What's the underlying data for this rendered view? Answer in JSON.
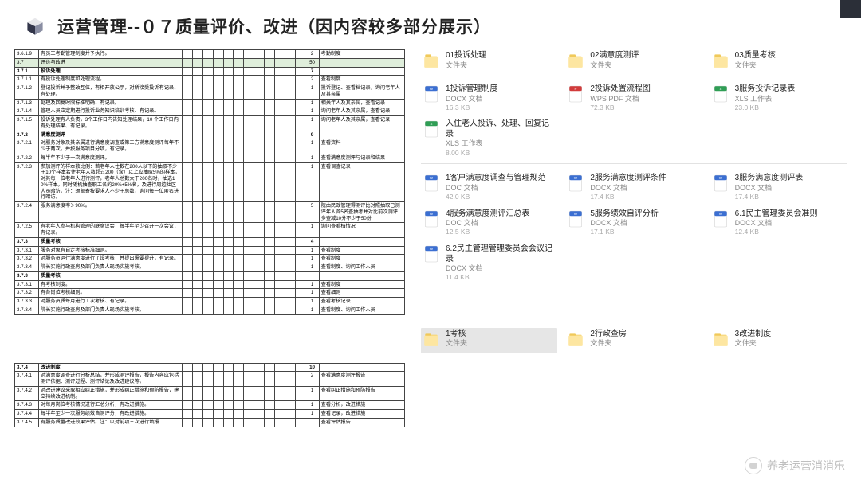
{
  "header": {
    "title": "运营管理--０７质量评价、改进（因内容较多部分展示）"
  },
  "table1": {
    "rows": [
      {
        "id": "3.6.1.9",
        "txt": "有员工考勤管理制度并予执行。",
        "blanks": 12,
        "score": "2",
        "note": "考勤制度"
      },
      {
        "id": "3.7",
        "txt": "评价与改进",
        "hdr": true,
        "blanks": 12,
        "score": "50",
        "note": ""
      },
      {
        "id": "3.7.1",
        "txt": "投诉处理",
        "sub": true,
        "blanks": 12,
        "score": "7",
        "note": ""
      },
      {
        "id": "3.7.1.1",
        "txt": "有投诉处理制度和处理流程。",
        "blanks": 12,
        "score": "2",
        "note": "查看制度"
      },
      {
        "id": "3.7.1.2",
        "txt": "登记投诉并予整改互位，有相开放公示，对所接受投诉有记录、有处理。",
        "blanks": 12,
        "score": "1",
        "note": "投诉登记、查看档记录，询问老年人及其亲属"
      },
      {
        "id": "3.7.1.3",
        "txt": "处理及回复时限标准明确、有记录。",
        "blanks": 12,
        "score": "1",
        "note": "相关年人及其亲属，查看记录"
      },
      {
        "id": "3.7.1.4",
        "txt": "管理人员应定期进行投诉业务知识培训考核、有记录。",
        "blanks": 12,
        "score": "1",
        "note": "询问老年人及其亲属，查看记录"
      },
      {
        "id": "3.7.1.5",
        "txt": "投诉处理有人负责，3个工作日内告知处理结果，10 个工作日内有处理结果、有记录。",
        "blanks": 12,
        "score": "1",
        "note": "询问老年人及其亲属，查看记录"
      },
      {
        "id": "3.7.2",
        "txt": "满意度测评",
        "sub": true,
        "blanks": 12,
        "score": "9",
        "note": ""
      },
      {
        "id": "3.7.2.1",
        "txt": "对服务对象及其亲属进行满意度调查或第三方满意度测评每年不少于两次，并按服务项目分项，有记录。",
        "blanks": 12,
        "score": "1",
        "note": "查看资料"
      },
      {
        "id": "3.7.2.2",
        "txt": "每半年不少于一次满意度测评。",
        "blanks": 12,
        "score": "1",
        "note": "查看满意度测评与记录和结果"
      },
      {
        "id": "3.7.2.3",
        "txt": "参加测评的样本数比例：若老年人住数在200人以下的抽取不少于10个样本若住老年人数超过200（含）以上应抽取5%的样本，对其每一位老年人进行测评，老年人总数大于200名时，抽选10%样本。同时随机抽查职工名的20%+5%名，及进行周边社区人员暗访。注：须邮寄按要求人不少于总数，询问每一位匿名进行暗访。",
        "blanks": 12,
        "score": "1",
        "note": "查看调查记录"
      },
      {
        "id": "3.7.2.4",
        "txt": "服务满意度率＞90%。",
        "blanks": 12,
        "score": "5",
        "note": "院由民政管理得测评比对照抽取已测评年人各5名查抽考并对比前次测评多查减10分不少于50份"
      },
      {
        "id": "3.7.2.5",
        "txt": "有老年人参与机构管理的联席议会，每半年至少召开一次会议，有记录。",
        "blanks": 12,
        "score": "1",
        "note": "询问查看档情况"
      },
      {
        "id": "3.7.3",
        "txt": "质量考核",
        "sub": true,
        "blanks": 12,
        "score": "4",
        "note": ""
      },
      {
        "id": "3.7.3.1",
        "txt": "服务对象有自定考核标准细则。",
        "blanks": 12,
        "score": "1",
        "note": "查看制度"
      },
      {
        "id": "3.7.3.2",
        "txt": "对服务员运行满意度进行了设考核，并提出需要提升，有记录。",
        "blanks": 12,
        "score": "1",
        "note": "查看制度"
      },
      {
        "id": "3.7.3.4",
        "txt": "院长实施行政查房及部门负责人现场实施考核。",
        "blanks": 12,
        "score": "1",
        "note": "查看制度、询问工作人员"
      },
      {
        "id": "3.7.3",
        "txt": "质量考核",
        "sub": true,
        "blanks": 12,
        "score": "",
        "note": ""
      },
      {
        "id": "3.7.3.1",
        "txt": "有考核制度。",
        "blanks": 12,
        "score": "1",
        "note": "查看制度"
      },
      {
        "id": "3.7.3.2",
        "txt": "有各岗位考核细则。",
        "blanks": 12,
        "score": "1",
        "note": "查看细则"
      },
      {
        "id": "3.7.3.3",
        "txt": "对服务员质每月进行１次考核、有记录。",
        "blanks": 12,
        "score": "1",
        "note": "查看考核记录"
      },
      {
        "id": "3.7.3.4",
        "txt": "院长实施行政查房及部门负责人现场实施考核。",
        "blanks": 12,
        "score": "1",
        "note": "查看制度、询问工作人员"
      }
    ]
  },
  "table2": {
    "rows": [
      {
        "id": "3.7.4",
        "txt": "改进制度",
        "sub": true,
        "blanks": 12,
        "score": "10",
        "note": ""
      },
      {
        "id": "3.7.4.1",
        "txt": "对满意度调查进行分析总结，并形成测评报告，报告内容应包括测评依据、测评过程、测评结论及改进建议等。",
        "blanks": 12,
        "score": "2",
        "note": "查看满意度测评报告"
      },
      {
        "id": "3.7.4.2",
        "txt": "对改进建议采取相应纠正措施，并形成纠正措施和预防报告，建立持续改进机制。",
        "blanks": 12,
        "score": "1",
        "note": "查看纠正措施和预防报告"
      },
      {
        "id": "3.7.4.3",
        "txt": "对每月岗位考核情况进行汇总分析，有改进措施。",
        "blanks": 12,
        "score": "1",
        "note": "查看分析，改进措施"
      },
      {
        "id": "3.7.4.4",
        "txt": "每半年至少一次服务绩效自测评分，有改进措施。",
        "blanks": 12,
        "score": "1",
        "note": "查看记录，改进措施"
      },
      {
        "id": "3.7.4.5",
        "txt": "有服务质量改进效果评估。注：以对前项三次进行填报",
        "blanks": 12,
        "score": "",
        "note": "查看评估报告"
      }
    ]
  },
  "files": {
    "group1": [
      {
        "name": "01投诉处理",
        "l2": "文件夹",
        "ic": "folder"
      },
      {
        "name": "02满意度测评",
        "l2": "文件夹",
        "ic": "folder"
      },
      {
        "name": "03质量考核",
        "l2": "文件夹",
        "ic": "folder"
      }
    ],
    "group2": [
      {
        "name": "1投诉管理制度",
        "l2": "DOCX 文档",
        "l3": "16.3 KB",
        "ic": "docx"
      },
      {
        "name": "2投诉处置流程图",
        "l2": "WPS PDF 文档",
        "l3": "72.3 KB",
        "ic": "pdf"
      },
      {
        "name": "3服务投诉记录表",
        "l2": "XLS 工作表",
        "l3": "23.0 KB",
        "ic": "xls"
      },
      {
        "name": "入住老人投诉、处理、回复记录",
        "l2": "XLS 工作表",
        "l3": "8.00 KB",
        "ic": "xls"
      }
    ],
    "group3": [
      {
        "name": "1客户满意度调查与管理规范",
        "l2": "DOC 文档",
        "l3": "42.0 KB",
        "ic": "docx"
      },
      {
        "name": "2服务满意度测评条件",
        "l2": "DOCX 文档",
        "l3": "17.4 KB",
        "ic": "docx"
      },
      {
        "name": "3服务满意度测评表",
        "l2": "DOCX 文档",
        "l3": "17.4 KB",
        "ic": "docx"
      },
      {
        "name": "4服务满意度测评汇总表",
        "l2": "DOC 文档",
        "l3": "12.5 KB",
        "ic": "docx"
      },
      {
        "name": "5服务绩效自评分析",
        "l2": "DOCX 文档",
        "l3": "17.1 KB",
        "ic": "docx"
      },
      {
        "name": "6.1民主管理委员会准则",
        "l2": "DOCX 文档",
        "l3": "12.4 KB",
        "ic": "docx"
      },
      {
        "name": "6.2民主管理管理委员会会议记录",
        "l2": "DOCX 文档",
        "l3": "11.4 KB",
        "ic": "docx"
      }
    ],
    "group4": [
      {
        "name": "1考核",
        "l2": "文件夹",
        "ic": "folder",
        "sel": true
      },
      {
        "name": "2行政查房",
        "l2": "文件夹",
        "ic": "folder"
      },
      {
        "name": "3改进制度",
        "l2": "文件夹",
        "ic": "folder"
      }
    ]
  },
  "watermark": "养老运营消消乐"
}
